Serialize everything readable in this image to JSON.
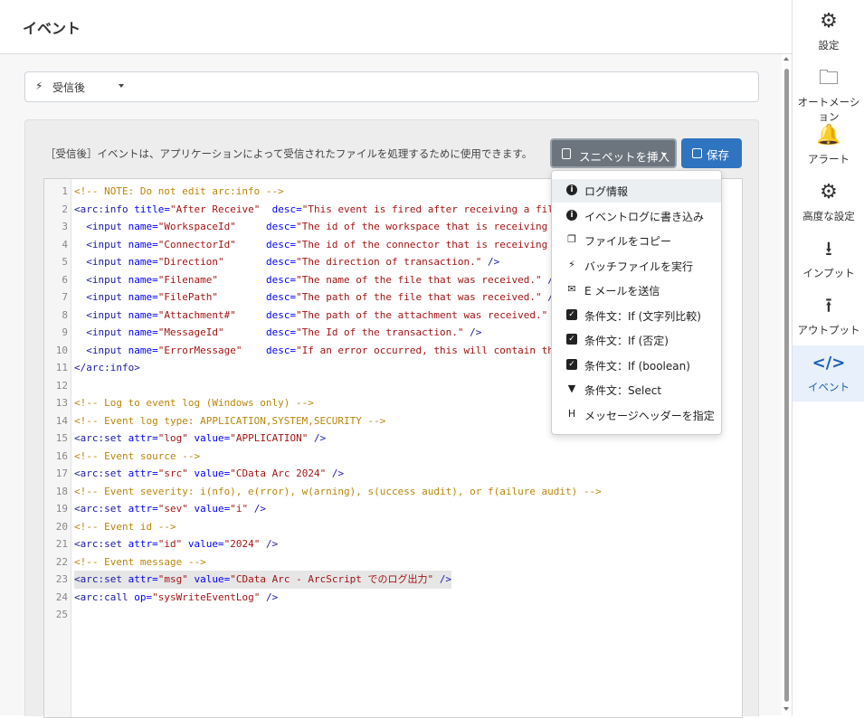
{
  "header": {
    "title": "イベント"
  },
  "trigger": {
    "icon": "bolt-icon",
    "label": "受信後"
  },
  "panel": {
    "description": "［受信後］イベントは、アプリケーションによって受信されたファイルを処理するために使用できます。",
    "snippet_button": "スニペットを挿入",
    "save_button": "保存"
  },
  "code_lines": [
    {
      "n": "1",
      "parts": [
        [
          "c",
          "<!-- NOTE: Do not edit arc:info -->"
        ]
      ]
    },
    {
      "n": "2",
      "parts": [
        [
          "t",
          "<arc:info "
        ],
        [
          "a",
          "title="
        ],
        [
          "s",
          "\"After Receive\"  "
        ],
        [
          "a",
          "desc="
        ],
        [
          "s",
          "\"This event is fired after receiving a file."
        ]
      ]
    },
    {
      "n": "3",
      "parts": [
        [
          "p",
          "  "
        ],
        [
          "t",
          "<input "
        ],
        [
          "a",
          "name="
        ],
        [
          "s",
          "\"WorkspaceId\"     "
        ],
        [
          "a",
          "desc="
        ],
        [
          "s",
          "\"The id of the workspace that is receiving"
        ]
      ]
    },
    {
      "n": "4",
      "parts": [
        [
          "p",
          "  "
        ],
        [
          "t",
          "<input "
        ],
        [
          "a",
          "name="
        ],
        [
          "s",
          "\"ConnectorId\"     "
        ],
        [
          "a",
          "desc="
        ],
        [
          "s",
          "\"The id of the connector that is receiving"
        ]
      ]
    },
    {
      "n": "5",
      "parts": [
        [
          "p",
          "  "
        ],
        [
          "t",
          "<input "
        ],
        [
          "a",
          "name="
        ],
        [
          "s",
          "\"Direction\"       "
        ],
        [
          "a",
          "desc="
        ],
        [
          "s",
          "\"The direction of transaction.\" "
        ],
        [
          "t",
          "/>"
        ]
      ]
    },
    {
      "n": "6",
      "parts": [
        [
          "p",
          "  "
        ],
        [
          "t",
          "<input "
        ],
        [
          "a",
          "name="
        ],
        [
          "s",
          "\"Filename\"        "
        ],
        [
          "a",
          "desc="
        ],
        [
          "s",
          "\"The name of the file that was received.\" "
        ],
        [
          "t",
          "/>"
        ]
      ]
    },
    {
      "n": "7",
      "parts": [
        [
          "p",
          "  "
        ],
        [
          "t",
          "<input "
        ],
        [
          "a",
          "name="
        ],
        [
          "s",
          "\"FilePath\"        "
        ],
        [
          "a",
          "desc="
        ],
        [
          "s",
          "\"The path of the file that was received.\" "
        ],
        [
          "t",
          "/>"
        ]
      ]
    },
    {
      "n": "8",
      "parts": [
        [
          "p",
          "  "
        ],
        [
          "t",
          "<input "
        ],
        [
          "a",
          "name="
        ],
        [
          "s",
          "\"Attachment#\"     "
        ],
        [
          "a",
          "desc="
        ],
        [
          "s",
          "\"The path of the attachment was received.\" "
        ],
        [
          "t",
          "/>"
        ]
      ]
    },
    {
      "n": "9",
      "parts": [
        [
          "p",
          "  "
        ],
        [
          "t",
          "<input "
        ],
        [
          "a",
          "name="
        ],
        [
          "s",
          "\"MessageId\"       "
        ],
        [
          "a",
          "desc="
        ],
        [
          "s",
          "\"The Id of the transaction.\" "
        ],
        [
          "t",
          "/>"
        ]
      ]
    },
    {
      "n": "10",
      "parts": [
        [
          "p",
          "  "
        ],
        [
          "t",
          "<input "
        ],
        [
          "a",
          "name="
        ],
        [
          "s",
          "\"ErrorMessage\"    "
        ],
        [
          "a",
          "desc="
        ],
        [
          "s",
          "\"If an error occurred, this will contain the"
        ]
      ]
    },
    {
      "n": "11",
      "parts": [
        [
          "t",
          "</arc:info>"
        ]
      ]
    },
    {
      "n": "12",
      "parts": []
    },
    {
      "n": "13",
      "parts": [
        [
          "c",
          "<!-- Log to event log (Windows only) -->"
        ]
      ]
    },
    {
      "n": "14",
      "parts": [
        [
          "c",
          "<!-- Event log type: APPLICATION,SYSTEM,SECURITY -->"
        ]
      ]
    },
    {
      "n": "15",
      "parts": [
        [
          "t",
          "<arc:set "
        ],
        [
          "a",
          "attr="
        ],
        [
          "s",
          "\"log\" "
        ],
        [
          "a",
          "value="
        ],
        [
          "s",
          "\"APPLICATION\" "
        ],
        [
          "t",
          "/>"
        ]
      ]
    },
    {
      "n": "16",
      "parts": [
        [
          "c",
          "<!-- Event source -->"
        ]
      ]
    },
    {
      "n": "17",
      "parts": [
        [
          "t",
          "<arc:set "
        ],
        [
          "a",
          "attr="
        ],
        [
          "s",
          "\"src\" "
        ],
        [
          "a",
          "value="
        ],
        [
          "s",
          "\"CData Arc 2024\" "
        ],
        [
          "t",
          "/>"
        ]
      ]
    },
    {
      "n": "18",
      "parts": [
        [
          "c",
          "<!-- Event severity: i(nfo), e(rror), w(arning), s(uccess audit), or f(ailure audit) -->"
        ]
      ]
    },
    {
      "n": "19",
      "parts": [
        [
          "t",
          "<arc:set "
        ],
        [
          "a",
          "attr="
        ],
        [
          "s",
          "\"sev\" "
        ],
        [
          "a",
          "value="
        ],
        [
          "s",
          "\"i\" "
        ],
        [
          "t",
          "/>"
        ]
      ]
    },
    {
      "n": "20",
      "parts": [
        [
          "c",
          "<!-- Event id -->"
        ]
      ]
    },
    {
      "n": "21",
      "parts": [
        [
          "t",
          "<arc:set "
        ],
        [
          "a",
          "attr="
        ],
        [
          "s",
          "\"id\" "
        ],
        [
          "a",
          "value="
        ],
        [
          "s",
          "\"2024\" "
        ],
        [
          "t",
          "/>"
        ]
      ]
    },
    {
      "n": "22",
      "parts": [
        [
          "c",
          "<!-- Event message -->"
        ]
      ]
    },
    {
      "n": "23",
      "hl": true,
      "parts": [
        [
          "t",
          "<arc:set "
        ],
        [
          "a",
          "attr="
        ],
        [
          "s",
          "\"msg\" "
        ],
        [
          "a",
          "value="
        ],
        [
          "s",
          "\"CData Arc - ArcScript でのログ出力\" "
        ],
        [
          "t",
          "/>"
        ]
      ]
    },
    {
      "n": "24",
      "parts": [
        [
          "t",
          "<arc:call "
        ],
        [
          "a",
          "op="
        ],
        [
          "s",
          "\"sysWriteEventLog\" "
        ],
        [
          "t",
          "/>"
        ]
      ]
    },
    {
      "n": "25",
      "parts": []
    }
  ],
  "dropdown": {
    "items": [
      {
        "icon": "info-icon",
        "glyph": "i",
        "style": "circle",
        "label": "ログ情報",
        "active": true
      },
      {
        "icon": "info-icon",
        "glyph": "i",
        "style": "circle",
        "label": "イベントログに書き込み"
      },
      {
        "icon": "copy-icon",
        "glyph": "❐",
        "style": "plain",
        "label": "ファイルをコピー"
      },
      {
        "icon": "bolt-icon",
        "glyph": "⚡",
        "style": "plain",
        "label": "バッチファイルを実行"
      },
      {
        "icon": "envelope-icon",
        "glyph": "✉",
        "style": "plain",
        "label": "E メールを送信"
      },
      {
        "icon": "check-square-icon",
        "glyph": "✓",
        "style": "check",
        "label": "条件文：If (文字列比較)"
      },
      {
        "icon": "check-square-icon",
        "glyph": "✓",
        "style": "check",
        "label": "条件文：If (否定)"
      },
      {
        "icon": "check-square-icon",
        "glyph": "✓",
        "style": "check",
        "label": "条件文：If (boolean)"
      },
      {
        "icon": "filter-icon",
        "glyph": "▼",
        "style": "plain",
        "label": "条件文：Select"
      },
      {
        "icon": "heading-icon",
        "glyph": "H",
        "style": "plain",
        "label": "メッセージヘッダーを指定"
      }
    ]
  },
  "sidebar": {
    "items": [
      {
        "icon": "gear-icon",
        "glyph": "⚙",
        "label": "設定"
      },
      {
        "icon": "folder-gear-icon",
        "glyph": "🗀",
        "label": "オートメーション"
      },
      {
        "icon": "bell-icon",
        "glyph": "🔔",
        "label": "アラート"
      },
      {
        "icon": "gears-icon",
        "glyph": "⚙",
        "label": "高度な設定"
      },
      {
        "icon": "download-icon",
        "glyph": "⭳",
        "label": "インプット"
      },
      {
        "icon": "upload-icon",
        "glyph": "⭱",
        "label": "アウトプット"
      },
      {
        "icon": "code-icon",
        "glyph": "</>",
        "label": "イベント",
        "active": true
      }
    ]
  },
  "colors": {
    "primary": "#2f74c0",
    "secondary": "#6c757d",
    "comment": "#b8860b",
    "active_side": "#1a5fb4"
  }
}
